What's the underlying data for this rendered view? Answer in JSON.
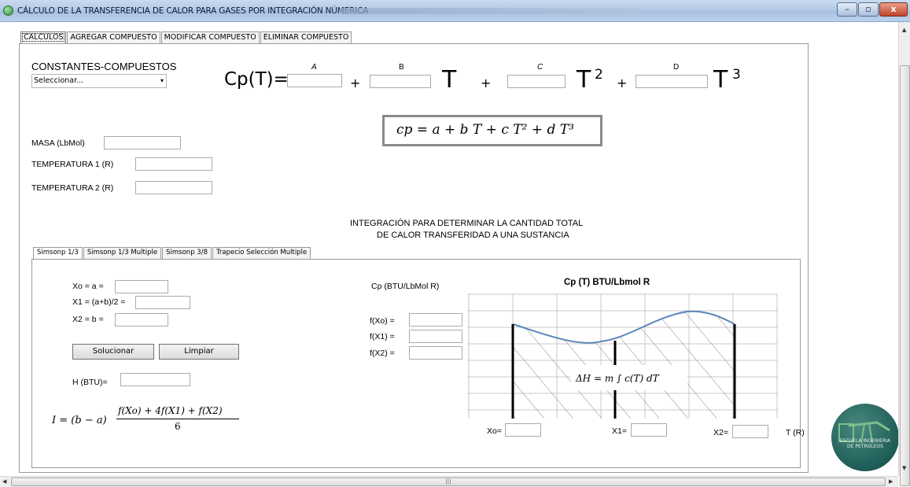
{
  "window": {
    "title": "CÁLCULO DE LA TRANSFERENCIA DE CALOR PARA GASES POR INTEGRACIÓN NÚMERICA",
    "minimize": "–",
    "maximize": "▫",
    "close": "x"
  },
  "tabs": [
    "CALCULOS",
    "AGREGAR COMPUESTO",
    "MODIFICAR COMPUESTO",
    "ELIMINAR COMPUESTO"
  ],
  "constants": {
    "label": "CONSTANTES-COMPUESTOS",
    "select_value": "Seleccionar...",
    "cp_label": "Cp(T)=",
    "a_label": "A",
    "b_label": "B",
    "c_label": "C",
    "d_label": "D",
    "plus": "+",
    "t": "T",
    "t2": "T",
    "exp2": "2",
    "t3": "T",
    "exp3": "3"
  },
  "formula": "cp = a + b T + c T² + d T³",
  "fields": {
    "masa": "MASA (LbMol)",
    "temp1": "TEMPERATURA 1 (R)",
    "temp2": "TEMPERATURA 2 (R)"
  },
  "heading": {
    "line1": "INTEGRACIÓN PARA DETERMINAR LA CANTIDAD TOTAL",
    "line2": "DE CALOR TRANSFERIDAD A UNA SUSTANCIA"
  },
  "method_tabs": [
    "Simsonp 1/3",
    "Simsonp 1/3 Multiple",
    "Simsonp 3/8",
    "Trapecio Selección Multiple"
  ],
  "simpson": {
    "xo": "Xo = a =",
    "x1": "X1 = (a+b)/2 =",
    "x2": "X2 = b =",
    "solve": "Solucionar",
    "clear": "Limpiar",
    "h": "H (BTU)=",
    "formula_lhs": "I = (b − a)",
    "formula_num": "f(Xo) + 4f(X1) + f(X2)",
    "formula_den": "6",
    "cp_axis": "Cp (BTU/LbMol R)",
    "fxo": "f(Xo) =",
    "fx1": "f(X1) =",
    "fx2": "f(X2) =",
    "chart_title": "Cp (T) BTU/Lbmol R",
    "integral": "ΔH = m ∫ c(T) dT",
    "int_upper": "T₂",
    "int_lower": "T₁",
    "xo_axis": "Xo=",
    "x1_axis": "X1=",
    "x2_axis": "X2=",
    "t_axis": "T (R)"
  },
  "logo": {
    "text": "ESCUELA INGENIERIA DE PETROLEOS"
  },
  "colors": {
    "curve": "#5b86b8",
    "title_bar": "#b3c9e6",
    "logo": "#1e5c57"
  }
}
